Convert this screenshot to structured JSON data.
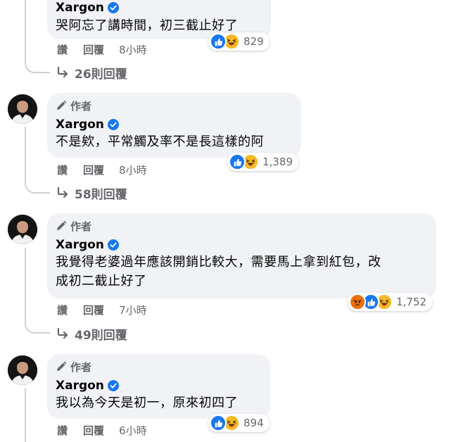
{
  "comments": [
    {
      "author_badge": "",
      "name": "Xargon",
      "text": "哭阿忘了講時間，初三截止好了",
      "actions": {
        "like": "讚",
        "reply": "回覆",
        "time": "8小時"
      },
      "reactions": {
        "types": [
          "like-icon",
          "haha-icon"
        ],
        "count": "829"
      },
      "replies": "26則回覆"
    },
    {
      "author_badge": "作者",
      "name": "Xargon",
      "text": "不是欸，平常觸及率不是長這樣的阿",
      "actions": {
        "like": "讚",
        "reply": "回覆",
        "time": "8小時"
      },
      "reactions": {
        "types": [
          "like-icon",
          "haha-icon"
        ],
        "count": "1,389"
      },
      "replies": "58則回覆"
    },
    {
      "author_badge": "作者",
      "name": "Xargon",
      "text_line1": "我覺得老婆過年應該開銷比較大，需要馬上拿到紅包，改",
      "text_line2": "成初二截止好了",
      "actions": {
        "like": "讚",
        "reply": "回覆",
        "time": "7小時"
      },
      "reactions": {
        "types": [
          "angry-icon",
          "like-icon",
          "haha-icon"
        ],
        "count": "1,752"
      },
      "replies": "49則回覆"
    },
    {
      "author_badge": "作者",
      "name": "Xargon",
      "text": "我以為今天是初一，原來初四了",
      "actions": {
        "like": "讚",
        "reply": "回覆",
        "time": "6小時"
      },
      "reactions": {
        "types": [
          "like-icon",
          "haha-icon"
        ],
        "count": "894"
      }
    }
  ],
  "colors": {
    "bubble": "#f0f2f5",
    "secondary_text": "#65676b",
    "like_blue": "#1877f2",
    "haha_yellow": "#f7b928",
    "angry_orange": "#e9710f",
    "thread_line": "#ced0d4"
  }
}
